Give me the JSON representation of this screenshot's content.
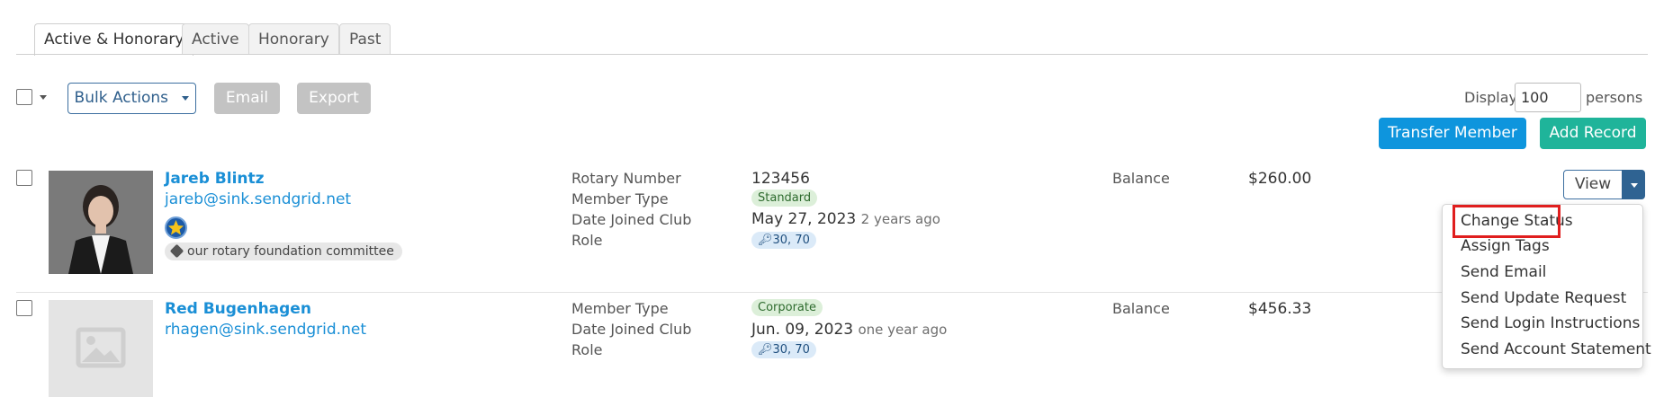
{
  "tabs": [
    {
      "label": "Active & Honorary",
      "active": true
    },
    {
      "label": "Active",
      "active": false
    },
    {
      "label": "Honorary",
      "active": false
    },
    {
      "label": "Past",
      "active": false
    }
  ],
  "toolbar": {
    "bulk_actions_label": "Bulk Actions",
    "email_label": "Email",
    "export_label": "Export",
    "display_label": "Display",
    "display_value": "100",
    "persons_label": "persons",
    "transfer_label": "Transfer Member",
    "add_record_label": "Add Record"
  },
  "members": [
    {
      "name": "Jareb Blintz",
      "email": "jareb@sink.sendgrid.net",
      "tag": "our rotary foundation committee",
      "fields": {
        "rotary_number_label": "Rotary Number",
        "rotary_number": "123456",
        "member_type_label": "Member Type",
        "member_type": "Standard",
        "date_joined_label": "Date Joined Club",
        "date_joined": "May 27, 2023",
        "date_joined_relative": "2 years ago",
        "role_label": "Role",
        "role": "30, 70"
      },
      "balance_label": "Balance",
      "balance": "$260.00",
      "view_label": "View"
    },
    {
      "name": "Red Bugenhagen",
      "email": "rhagen@sink.sendgrid.net",
      "fields": {
        "member_type_label": "Member Type",
        "member_type": "Corporate",
        "date_joined_label": "Date Joined Club",
        "date_joined": "Jun. 09, 2023",
        "date_joined_relative": "one year ago",
        "role_label": "Role",
        "role": "30, 70"
      },
      "balance_label": "Balance",
      "balance": "$456.33"
    }
  ],
  "dropdown_menu": {
    "items": [
      "Change Status",
      "Assign Tags",
      "Send Email",
      "Send Update Request",
      "Send Login Instructions",
      "Send Account Statement"
    ],
    "highlighted": "Change Status"
  },
  "colors": {
    "link": "#1a8fd6",
    "primary_blue": "#0e95dd",
    "teal": "#1fb49a",
    "highlight_red": "#e01e1e"
  }
}
